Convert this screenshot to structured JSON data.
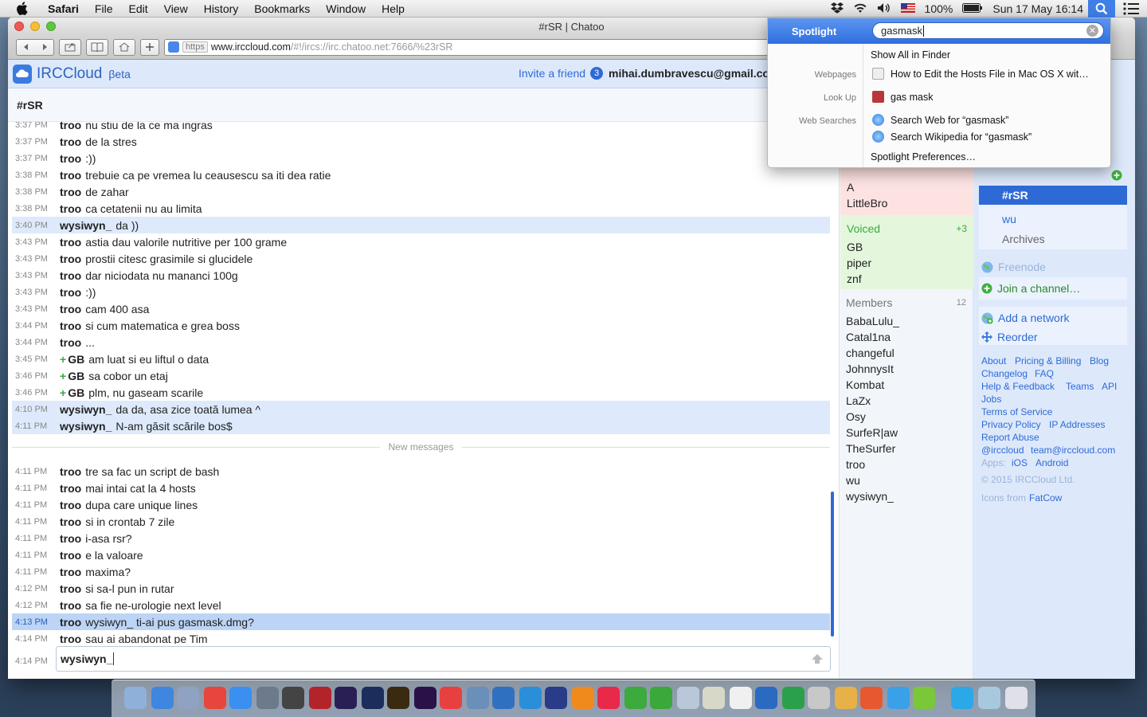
{
  "menubar": {
    "app": "Safari",
    "items": [
      "File",
      "Edit",
      "View",
      "History",
      "Bookmarks",
      "Window",
      "Help"
    ],
    "battery": "100%",
    "clock": "Sun 17 May  16:14"
  },
  "window": {
    "title": "#rSR | Chatoo",
    "url_scheme": "https",
    "url_host": "www.irccloud.com",
    "url_path": "/#!/ircs://irc.chatoo.net:7666/%23rSR"
  },
  "app": {
    "logo": "IRCCloud",
    "beta": "βeta",
    "invite": "Invite a friend",
    "invite_count": "3",
    "user_email": "mihai.dumbravescu@gmail.co"
  },
  "channel": {
    "name": "#rSR"
  },
  "messages_top": [
    {
      "time": "3:37 PM",
      "nick": "troo",
      "text": "nu stiu de la ce ma ingras",
      "style": "normal"
    },
    {
      "time": "3:37 PM",
      "nick": "troo",
      "text": "de la stres",
      "style": "normal"
    },
    {
      "time": "3:37 PM",
      "nick": "troo",
      "text": ":))",
      "style": "normal"
    },
    {
      "time": "3:38 PM",
      "nick": "troo",
      "text": "trebuie ca pe vremea lu ceausescu sa iti dea ratie",
      "style": "normal"
    },
    {
      "time": "3:38 PM",
      "nick": "troo",
      "text": "de zahar",
      "style": "normal"
    },
    {
      "time": "3:38 PM",
      "nick": "troo",
      "text": "ca cetatenii nu au limita",
      "style": "normal"
    },
    {
      "time": "3:40 PM",
      "nick": "wysiwyn_",
      "text": "da ))",
      "style": "hl"
    },
    {
      "time": "3:43 PM",
      "nick": "troo",
      "text": "astia dau valorile nutritive per 100 grame",
      "style": "normal"
    },
    {
      "time": "3:43 PM",
      "nick": "troo",
      "text": "prostii citesc grasimile si glucidele",
      "style": "normal"
    },
    {
      "time": "3:43 PM",
      "nick": "troo",
      "text": "dar niciodata nu mananci 100g",
      "style": "normal"
    },
    {
      "time": "3:43 PM",
      "nick": "troo",
      "text": ":))",
      "style": "normal"
    },
    {
      "time": "3:43 PM",
      "nick": "troo",
      "text": "cam 400 asa",
      "style": "normal"
    },
    {
      "time": "3:44 PM",
      "nick": "troo",
      "text": "si cum matematica e grea boss",
      "style": "normal"
    },
    {
      "time": "3:44 PM",
      "nick": "troo",
      "text": "...",
      "style": "normal"
    },
    {
      "time": "3:45 PM",
      "nick": "GB",
      "text": "am luat si eu liftul o data",
      "style": "normal",
      "voiced": true
    },
    {
      "time": "3:46 PM",
      "nick": "GB",
      "text": "sa cobor un etaj",
      "style": "normal",
      "voiced": true
    },
    {
      "time": "3:46 PM",
      "nick": "GB",
      "text": "plm, nu gaseam scarile",
      "style": "normal",
      "voiced": true
    },
    {
      "time": "4:10 PM",
      "nick": "wysiwyn_",
      "text": "da da, asa zice toată lumea ^",
      "style": "hl"
    },
    {
      "time": "4:11 PM",
      "nick": "wysiwyn_",
      "text": "N-am găsit scările bos$",
      "style": "hl"
    }
  ],
  "new_messages_label": "New messages",
  "messages_bottom": [
    {
      "time": "4:11 PM",
      "nick": "troo",
      "text": "tre sa fac un script de bash",
      "style": "normal"
    },
    {
      "time": "4:11 PM",
      "nick": "troo",
      "text": "mai intai cat la 4 hosts",
      "style": "normal"
    },
    {
      "time": "4:11 PM",
      "nick": "troo",
      "text": "dupa care unique lines",
      "style": "normal"
    },
    {
      "time": "4:11 PM",
      "nick": "troo",
      "text": "si in crontab 7 zile",
      "style": "normal"
    },
    {
      "time": "4:11 PM",
      "nick": "troo",
      "text": "i-asa rsr?",
      "style": "normal"
    },
    {
      "time": "4:11 PM",
      "nick": "troo",
      "text": "e la valoare",
      "style": "normal"
    },
    {
      "time": "4:11 PM",
      "nick": "troo",
      "text": "maxima?",
      "style": "normal"
    },
    {
      "time": "4:12 PM",
      "nick": "troo",
      "text": "si sa-l pun in rutar",
      "style": "normal"
    },
    {
      "time": "4:12 PM",
      "nick": "troo",
      "text": "sa fie ne-urologie next level",
      "style": "normal"
    },
    {
      "time": "4:13 PM",
      "nick": "troo",
      "text": "wysiwyn_ ti-ai pus gasmask.dmg?",
      "style": "sel"
    },
    {
      "time": "4:14 PM",
      "nick": "troo",
      "text": "sau ai abandonat pe Tim",
      "style": "normal"
    }
  ],
  "input": {
    "time": "4:14 PM",
    "nick": "wysiwyn_"
  },
  "members": {
    "ops_visible": [
      "A",
      "LittleBro"
    ],
    "voiced_label": "Voiced",
    "voiced_count": "+3",
    "voiced": [
      "GB",
      "piper",
      "znf"
    ],
    "members_label": "Members",
    "members_count": "12",
    "list": [
      "BabaLulu_",
      "Catal1na",
      "changeful",
      "JohnnysIt",
      "Kombat",
      "LaZx",
      "Osy",
      "SurfeR|aw",
      "TheSurfer",
      "troo",
      "wu",
      "wysiwyn_"
    ]
  },
  "sidebar": {
    "active_channel": "#rSR",
    "other_channel": "wu",
    "archives": "Archives",
    "network2": "Freenode",
    "join": "Join a channel…",
    "add_network": "Add a network",
    "reorder": "Reorder",
    "links": {
      "about": "About",
      "pricing": "Pricing & Billing",
      "blog": "Blog",
      "changelog": "Changelog",
      "faq": "FAQ",
      "help": "Help & Feedback",
      "teams": "Teams",
      "api": "API",
      "jobs": "Jobs",
      "tos": "Terms of Service",
      "privacy": "Privacy Policy",
      "ip": "IP Addresses",
      "abuse": "Report Abuse",
      "twitter": "@irccloud",
      "email": "team@irccloud.com",
      "apps": "Apps:",
      "ios": "iOS",
      "android": "Android",
      "copyright": "© 2015 IRCCloud Ltd.",
      "icons_from": "Icons from",
      "fatcow": "FatCow"
    }
  },
  "spotlight": {
    "title": "Spotlight",
    "query": "gasmask",
    "show_all": "Show All in Finder",
    "cat_webpages": "Webpages",
    "res_webpage": "How to Edit the Hosts File in Mac OS X wit…",
    "cat_lookup": "Look Up",
    "res_lookup": "gas mask",
    "cat_websearch": "Web Searches",
    "res_web": "Search Web for “gasmask”",
    "res_wiki": "Search Wikipedia for “gasmask”",
    "prefs": "Spotlight Preferences…"
  },
  "colors": {
    "accent": "#2e6ad6",
    "highlight": "#deeafb",
    "selected": "#bcd4f6",
    "ops_bg": "#fde2e2",
    "voiced_bg": "#e4f7dc",
    "voiced_text": "#3ca83c"
  }
}
